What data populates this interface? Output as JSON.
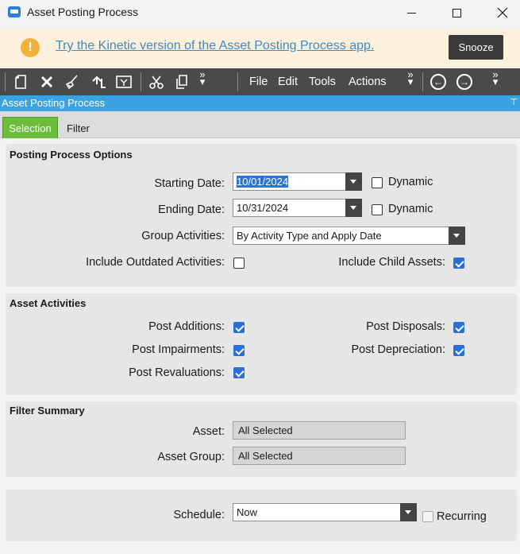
{
  "window": {
    "title": "Asset Posting Process"
  },
  "banner": {
    "link_text": "Try the Kinetic version of the Asset Posting Process app.",
    "snooze_label": "Snooze"
  },
  "toolbar": {
    "menus": [
      "File",
      "Edit",
      "Tools",
      "Actions"
    ]
  },
  "header": {
    "title": "Asset Posting Process"
  },
  "tabs": [
    {
      "label": "Selection",
      "selected": true
    },
    {
      "label": "Filter",
      "selected": false
    }
  ],
  "posting_options": {
    "title": "Posting Process Options",
    "starting_date_label": "Starting Date:",
    "starting_date": "10/01/2024",
    "ending_date_label": "Ending Date:",
    "ending_date": "10/31/2024",
    "dynamic_label": "Dynamic",
    "group_activities_label": "Group Activities:",
    "group_activities": "By Activity Type and Apply Date",
    "include_outdated_label": "Include Outdated Activities:",
    "include_child_label": "Include Child Assets:"
  },
  "asset_activities": {
    "title": "Asset Activities",
    "post_additions": "Post Additions:",
    "post_disposals": "Post Disposals:",
    "post_impairments": "Post Impairments:",
    "post_depreciation": "Post Depreciation:",
    "post_revaluations": "Post Revaluations:"
  },
  "filter_summary": {
    "title": "Filter Summary",
    "asset_label": "Asset:",
    "asset_value": "All Selected",
    "asset_group_label": "Asset Group:",
    "asset_group_value": "All Selected"
  },
  "schedule": {
    "label": "Schedule:",
    "value": "Now",
    "recurring_label": "Recurring"
  },
  "colors": {
    "accent": "#3aa2e0",
    "tab_selected": "#6bbd3c",
    "checkbox": "#2b6fd6",
    "toolbar": "#4a4a4a"
  }
}
